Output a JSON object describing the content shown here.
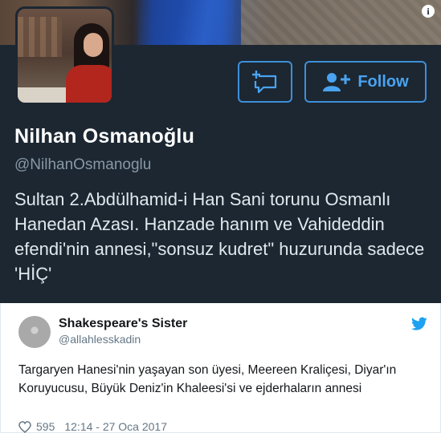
{
  "profile": {
    "name": "Nilhan Osmanoğlu",
    "handle": "@NilhanOsmanoglu",
    "bio": "Sultan 2.Abdülhamid-i Han Sani torunu Osmanlı Hanedan Azası. Hanzade hanım ve Vahideddin efendi'nin annesi,\"sonsuz kudret\" huzurunda sadece 'HİÇ'",
    "follow_label": "Follow",
    "info_glyph": "i",
    "icons": [
      "info-icon",
      "direct-message-icon",
      "add-user-icon"
    ],
    "colors": {
      "card_bg": "#1c2732",
      "accent": "#4aa3f0"
    }
  },
  "tweet": {
    "name": "Shakespeare's Sister",
    "handle": "@allahlesskadin",
    "text": "Targaryen Hanesi'nin yaşayan son üyesi, Meereen Kraliçesi, Diyar'ın Koruyucusu, Büyük Deniz'in Khaleesi'si ve ejderhaların annesi",
    "likes": "595",
    "timestamp": "12:14 - 27 Oca 2017",
    "icons": [
      "twitter-bird-icon",
      "heart-icon"
    ],
    "colors": {
      "brand": "#1da1f2"
    }
  }
}
